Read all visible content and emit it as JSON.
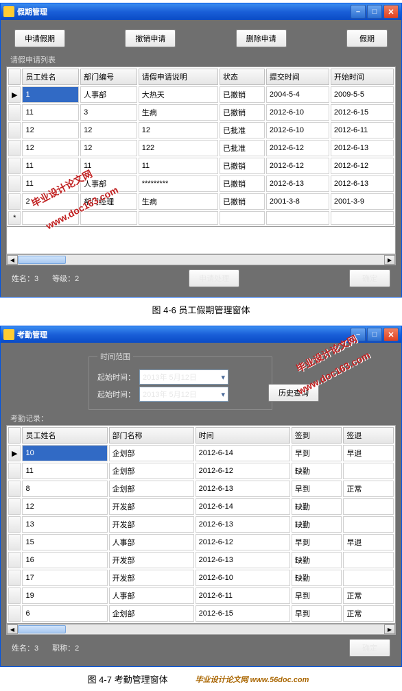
{
  "win1": {
    "title": "假期管理",
    "toolbar": {
      "b1": "申请假期",
      "b2": "撤销申请",
      "b3": "删除申请",
      "b4": "假期"
    },
    "listLabel": "请假申请列表",
    "cols": [
      "员工姓名",
      "部门编号",
      "请假申请说明",
      "状态",
      "提交时间",
      "开始时间"
    ],
    "rows": [
      [
        "1",
        "人事部",
        "大热天",
        "已撤销",
        "2004-5-4",
        "2009-5-5"
      ],
      [
        "11",
        "3",
        "生病",
        "已撤销",
        "2012-6-10",
        "2012-6-15"
      ],
      [
        "12",
        "12",
        "12",
        "已批准",
        "2012-6-10",
        "2012-6-11"
      ],
      [
        "12",
        "12",
        "122",
        "已批准",
        "2012-6-12",
        "2012-6-13"
      ],
      [
        "11",
        "11",
        "11",
        "已撤销",
        "2012-6-12",
        "2012-6-12"
      ],
      [
        "11",
        "人事部",
        "*********",
        "已撤销",
        "2012-6-13",
        "2012-6-13"
      ],
      [
        "2",
        "部门经理",
        "生病",
        "已撤销",
        "2001-3-8",
        "2001-3-9"
      ]
    ],
    "status": {
      "name": "姓名：",
      "nameVal": "3",
      "grade": "等级：",
      "gradeVal": "2",
      "btnProcess": "申请处理",
      "btnOk": "确定"
    },
    "caption": "图 4-6 员工假期管理窗体"
  },
  "win2": {
    "title": "考勤管理",
    "fieldsetLegend": "时间范围",
    "dateLabel": "起始时间：",
    "dateValue": "2013年 5月12日",
    "btnHistory": "历史查询",
    "listLabel": "考勤记录：",
    "cols": [
      "员工姓名",
      "部门名称",
      "时间",
      "签到",
      "签退"
    ],
    "rows": [
      [
        "10",
        "企划部",
        "2012-6-14",
        "早到",
        "早退"
      ],
      [
        "11",
        "企划部",
        "2012-6-12",
        "缺勤",
        ""
      ],
      [
        "8",
        "企划部",
        "2012-6-13",
        "早到",
        "正常"
      ],
      [
        "12",
        "开发部",
        "2012-6-14",
        "缺勤",
        ""
      ],
      [
        "13",
        "开发部",
        "2012-6-13",
        "缺勤",
        ""
      ],
      [
        "15",
        "人事部",
        "2012-6-12",
        "早到",
        "早退"
      ],
      [
        "16",
        "开发部",
        "2012-6-13",
        "缺勤",
        ""
      ],
      [
        "17",
        "开发部",
        "2012-6-10",
        "缺勤",
        ""
      ],
      [
        "19",
        "人事部",
        "2012-6-11",
        "早到",
        "正常"
      ],
      [
        "6",
        "企划部",
        "2012-6-15",
        "早到",
        "正常"
      ]
    ],
    "status": {
      "name": "姓名：",
      "nameVal": "3",
      "title2": "职称：",
      "titleVal": "2",
      "btnOk": "确定"
    },
    "caption": "图 4-7 考勤管理窗体"
  },
  "watermarks": {
    "w1": "毕业设计论文网",
    "w2": "www.doc163.com",
    "logo": "毕业设计论文网 www.56doc.com"
  }
}
